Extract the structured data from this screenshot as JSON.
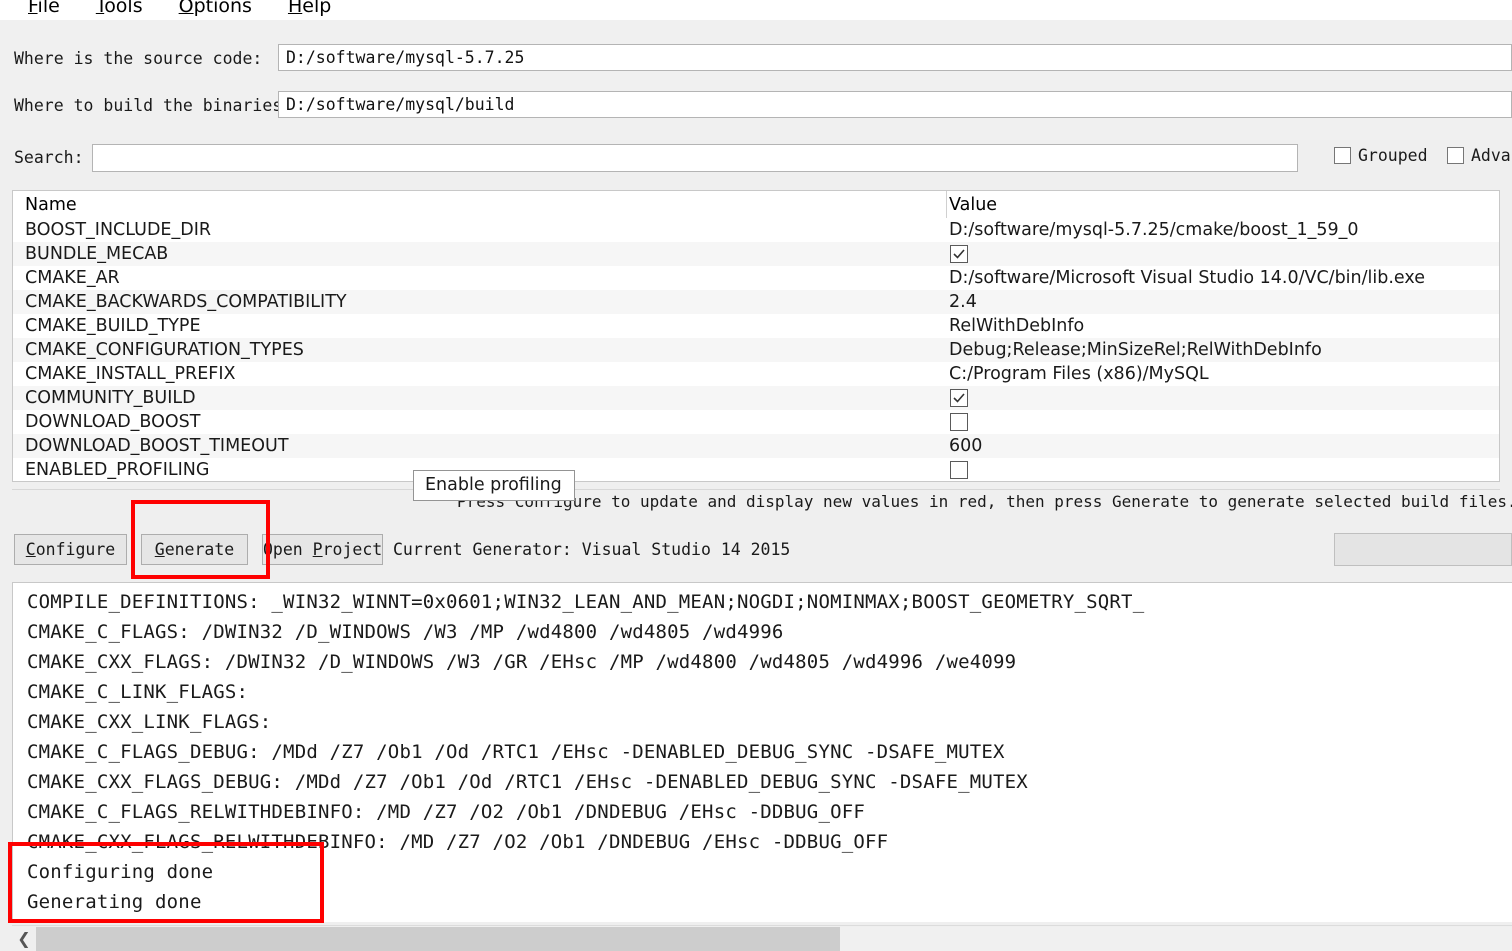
{
  "window": {
    "background": "#efefef",
    "accent_red": "#fe0000"
  },
  "menubar": {
    "items": [
      {
        "label": "File",
        "mnemonic": "F"
      },
      {
        "label": "Tools",
        "mnemonic": "T"
      },
      {
        "label": "Options",
        "mnemonic": "O"
      },
      {
        "label": "Help",
        "mnemonic": "H"
      }
    ]
  },
  "form": {
    "source_label": "Where is the source code:",
    "source_value": "D:/software/mysql-5.7.25",
    "build_label": "Where to build the binaries:",
    "build_value": "D:/software/mysql/build"
  },
  "search": {
    "label": "Search:",
    "value": "",
    "grouped_label": "Grouped",
    "grouped_checked": false,
    "advanced_label": "Advan",
    "advanced_checked": false
  },
  "table": {
    "headers": [
      "Name",
      "Value"
    ],
    "rows": [
      {
        "name": "BOOST_INCLUDE_DIR",
        "value": "D:/software/mysql-5.7.25/cmake/boost_1_59_0",
        "type": "text"
      },
      {
        "name": "BUNDLE_MECAB",
        "value": "",
        "type": "checkbox",
        "checked": true
      },
      {
        "name": "CMAKE_AR",
        "value": "D:/software/Microsoft Visual Studio 14.0/VC/bin/lib.exe",
        "type": "text"
      },
      {
        "name": "CMAKE_BACKWARDS_COMPATIBILITY",
        "value": "2.4",
        "type": "text"
      },
      {
        "name": "CMAKE_BUILD_TYPE",
        "value": "RelWithDebInfo",
        "type": "text"
      },
      {
        "name": "CMAKE_CONFIGURATION_TYPES",
        "value": "Debug;Release;MinSizeRel;RelWithDebInfo",
        "type": "text"
      },
      {
        "name": "CMAKE_INSTALL_PREFIX",
        "value": "C:/Program Files (x86)/MySQL",
        "type": "text"
      },
      {
        "name": "COMMUNITY_BUILD",
        "value": "",
        "type": "checkbox",
        "checked": true
      },
      {
        "name": "DOWNLOAD_BOOST",
        "value": "",
        "type": "checkbox",
        "checked": false
      },
      {
        "name": "DOWNLOAD_BOOST_TIMEOUT",
        "value": "600",
        "type": "text"
      },
      {
        "name": "ENABLED_PROFILING",
        "value": "",
        "type": "checkbox",
        "checked": false
      }
    ]
  },
  "tooltip": {
    "text": "Enable profiling"
  },
  "hint": {
    "text": "Press Configure to update and display new values in red, then press Generate to generate selected build files."
  },
  "buttons": {
    "configure": "Configure",
    "configure_mnemonic": "C",
    "generate": "Generate",
    "generate_mnemonic": "G",
    "open_project": "Open Project",
    "generator_status": "Current Generator: Visual Studio 14 2015"
  },
  "log": {
    "lines": [
      "COMPILE_DEFINITIONS: _WIN32_WINNT=0x0601;WIN32_LEAN_AND_MEAN;NOGDI;NOMINMAX;BOOST_GEOMETRY_SQRT_",
      "CMAKE_C_FLAGS: /DWIN32 /D_WINDOWS /W3 /MP /wd4800 /wd4805 /wd4996",
      "CMAKE_CXX_FLAGS: /DWIN32 /D_WINDOWS /W3 /GR /EHsc /MP /wd4800 /wd4805 /wd4996 /we4099",
      "CMAKE_C_LINK_FLAGS:",
      "CMAKE_CXX_LINK_FLAGS:",
      "CMAKE_C_FLAGS_DEBUG: /MDd /Z7 /Ob1 /Od /RTC1 /EHsc -DENABLED_DEBUG_SYNC -DSAFE_MUTEX",
      "CMAKE_CXX_FLAGS_DEBUG: /MDd /Z7 /Ob1 /Od /RTC1 /EHsc -DENABLED_DEBUG_SYNC -DSAFE_MUTEX",
      "CMAKE_C_FLAGS_RELWITHDEBINFO: /MD /Z7 /O2 /Ob1 /DNDEBUG /EHsc -DDBUG_OFF",
      "CMAKE_CXX_FLAGS_RELWITHDEBINFO: /MD /Z7 /O2 /Ob1 /DNDEBUG /EHsc -DDBUG_OFF",
      "Configuring done",
      "Generating done"
    ]
  },
  "scrollbar": {
    "left_arrow_glyph": "❮"
  }
}
